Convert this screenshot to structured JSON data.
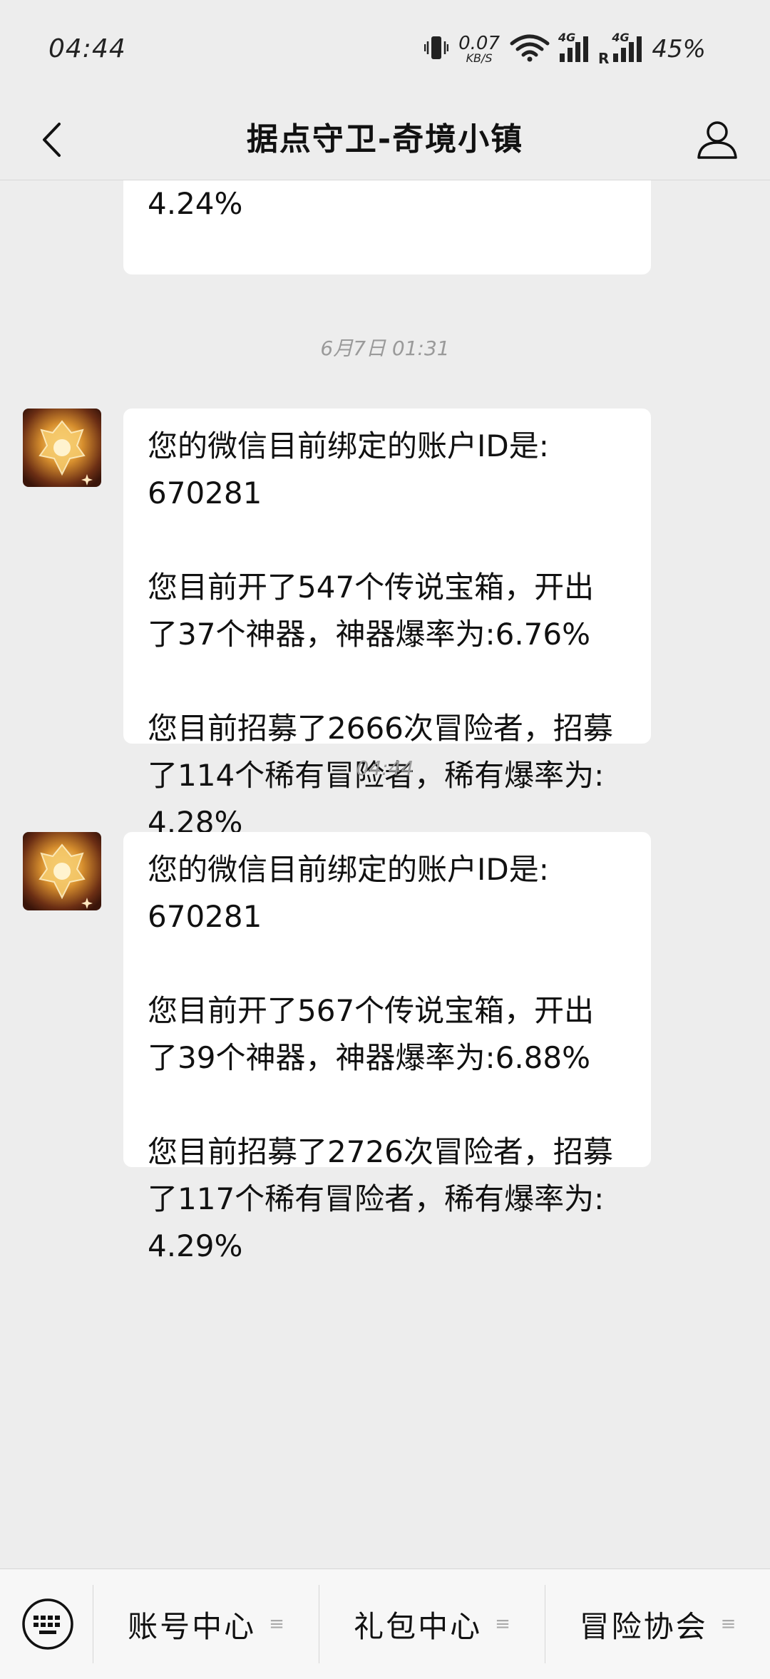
{
  "status_bar": {
    "time": "04:44",
    "net_speed_value": "0.07",
    "net_speed_unit": "KB/S",
    "network_tag_1": "4G",
    "network_tag_2": "4G",
    "roaming": "R",
    "battery": "45%"
  },
  "nav": {
    "title": "据点守卫-奇境小镇"
  },
  "chat": {
    "partial_message": "4.24%",
    "groups": [
      {
        "timestamp": "6月7日 01:31",
        "message": "您的微信目前绑定的账户ID是:\n670281\n\n您目前开了547个传说宝箱，开出\n了37个神器，神器爆率为:6.76%\n\n您目前招募了2666次冒险者，招募\n了114个稀有冒险者，稀有爆率为:\n4.28%"
      },
      {
        "timestamp": "04:44",
        "message": "您的微信目前绑定的账户ID是:\n670281\n\n您目前开了567个传说宝箱，开出\n了39个神器，神器爆率为:6.88%\n\n您目前招募了2726次冒险者，招募\n了117个稀有冒险者，稀有爆率为:\n4.29%"
      }
    ]
  },
  "bottom_menu": {
    "items": [
      {
        "label": "账号中心",
        "icon": "menu-lines-icon"
      },
      {
        "label": "礼包中心",
        "icon": "menu-lines-icon"
      },
      {
        "label": "冒险协会",
        "icon": "menu-lines-icon"
      }
    ]
  },
  "colors": {
    "background": "#ededed",
    "bubble": "#ffffff",
    "timestamp": "#9a9a9a",
    "menu_bg": "#f7f7f7"
  }
}
